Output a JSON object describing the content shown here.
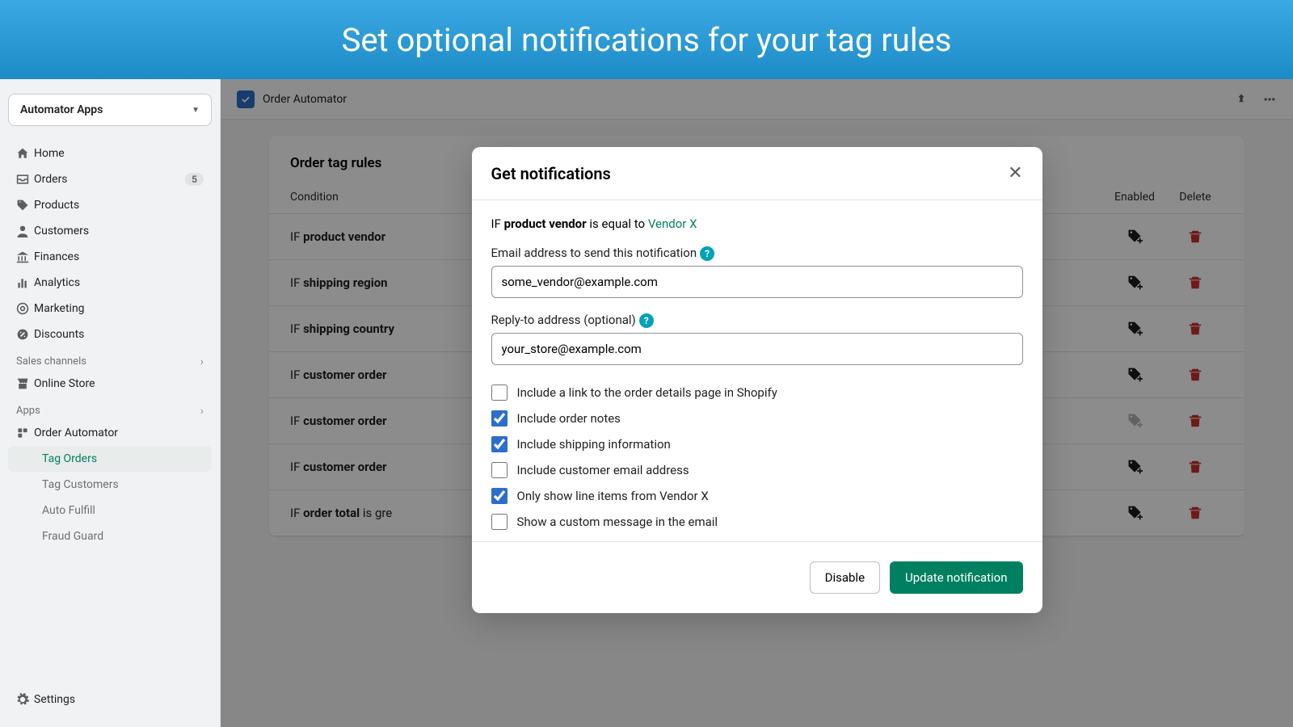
{
  "banner": {
    "title": "Set optional notifications for your tag rules"
  },
  "selector": {
    "label": "Automator Apps"
  },
  "nav": {
    "home": "Home",
    "orders": "Orders",
    "orders_badge": "5",
    "products": "Products",
    "customers": "Customers",
    "finances": "Finances",
    "analytics": "Analytics",
    "marketing": "Marketing",
    "discounts": "Discounts",
    "sales_channels": "Sales channels",
    "online_store": "Online Store",
    "apps": "Apps",
    "order_automator": "Order Automator",
    "tag_orders": "Tag Orders",
    "tag_customers": "Tag Customers",
    "auto_fulfill": "Auto Fulfill",
    "fraud_guard": "Fraud Guard",
    "settings": "Settings"
  },
  "topbar": {
    "title": "Order Automator"
  },
  "card": {
    "title": "Order tag rules",
    "col_condition": "Condition",
    "col_enabled": "Enabled",
    "col_delete": "Delete",
    "rows": [
      {
        "prefix": "IF ",
        "bold": "product vendor"
      },
      {
        "prefix": "IF ",
        "bold": "shipping region"
      },
      {
        "prefix": "IF ",
        "bold": "shipping country"
      },
      {
        "prefix": "IF ",
        "bold": "customer order"
      },
      {
        "prefix": "IF ",
        "bold": "customer order"
      },
      {
        "prefix": "IF ",
        "bold": "customer order"
      },
      {
        "prefix": "IF ",
        "bold": "order total",
        "suffix": " is gre"
      }
    ]
  },
  "modal": {
    "title": "Get notifications",
    "cond_prefix": "IF ",
    "cond_bold": "product vendor",
    "cond_mid": " is equal to ",
    "cond_vendor": "Vendor X",
    "email_label": "Email address to send this notification",
    "email_value": "some_vendor@example.com",
    "reply_label": "Reply-to address (optional)",
    "reply_value": "your_store@example.com",
    "checks": [
      {
        "label": "Include a link to the order details page in Shopify",
        "checked": false
      },
      {
        "label": "Include order notes",
        "checked": true
      },
      {
        "label": "Include shipping information",
        "checked": true
      },
      {
        "label": "Include customer email address",
        "checked": false
      },
      {
        "label": "Only show line items from Vendor X",
        "checked": true
      },
      {
        "label": "Show a custom message in the email",
        "checked": false
      }
    ],
    "btn_disable": "Disable",
    "btn_update": "Update notification"
  }
}
